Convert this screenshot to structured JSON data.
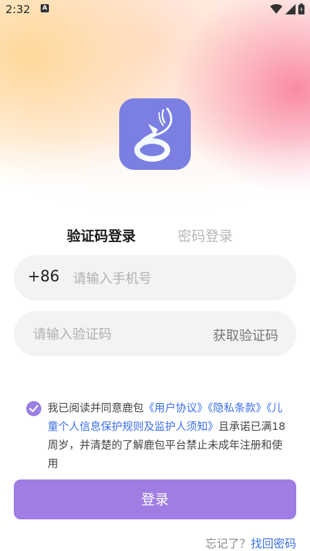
{
  "status_bar": {
    "time": "2:32",
    "notification_icon": "A",
    "icons": [
      "wifi-icon",
      "signal-icon",
      "battery-icon"
    ]
  },
  "logo": {
    "icon": "deer-logo-icon",
    "color": "#7b7fe2"
  },
  "tabs": [
    {
      "label": "验证码登录",
      "active": true
    },
    {
      "label": "密码登录",
      "active": false
    }
  ],
  "phone_field": {
    "country_code": "+86",
    "placeholder": "请输入手机号",
    "value": ""
  },
  "code_field": {
    "placeholder": "请输入验证码",
    "value": "",
    "get_code_label": "获取验证码"
  },
  "agreement": {
    "checked": true,
    "prefix": "我已阅读并同意鹿包",
    "link_user": "《用户协议》",
    "link_privacy": "《隐私条款》",
    "link_children": "《儿童个人信息保护规则及监护人须知》",
    "suffix": "且承诺已满18周岁，并清楚的了解鹿包平台禁止未成年注册和使用"
  },
  "login_button": {
    "label": "登录",
    "color": "#a07de2"
  },
  "footer": {
    "forgot_text": "忘记了？",
    "recover_link": "找回密码"
  },
  "colors": {
    "link": "#3a6ee8",
    "accent": "#9b7fe3"
  }
}
